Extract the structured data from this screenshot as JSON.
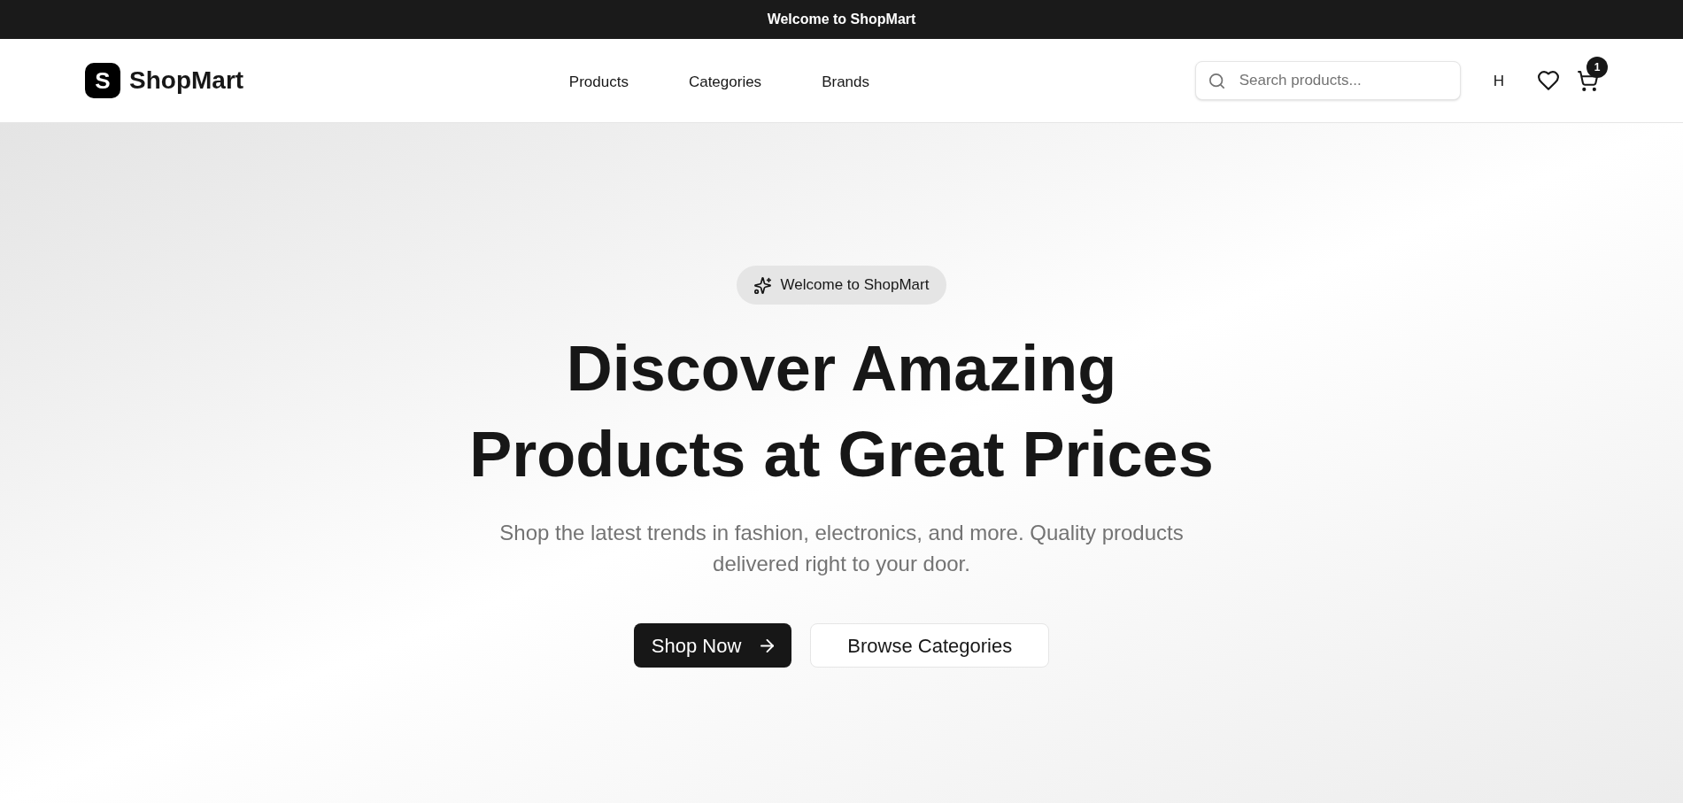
{
  "announcement_bar": {
    "text": "Welcome to ShopMart"
  },
  "header": {
    "logo": {
      "mark": "S",
      "name": "ShopMart"
    },
    "nav": [
      {
        "label": "Products"
      },
      {
        "label": "Categories"
      },
      {
        "label": "Brands"
      }
    ],
    "search": {
      "placeholder": "Search products..."
    },
    "user_initial": "H",
    "cart": {
      "count": "1"
    }
  },
  "hero": {
    "badge": "Welcome to ShopMart",
    "title": "Discover Amazing Products at Great Prices",
    "subtitle": "Shop the latest trends in fashion, electronics, and more. Quality products delivered right to your door.",
    "buttons": [
      {
        "label": "Shop Now",
        "kind": "primary"
      },
      {
        "label": "Browse Categories",
        "kind": "secondary"
      }
    ]
  }
}
